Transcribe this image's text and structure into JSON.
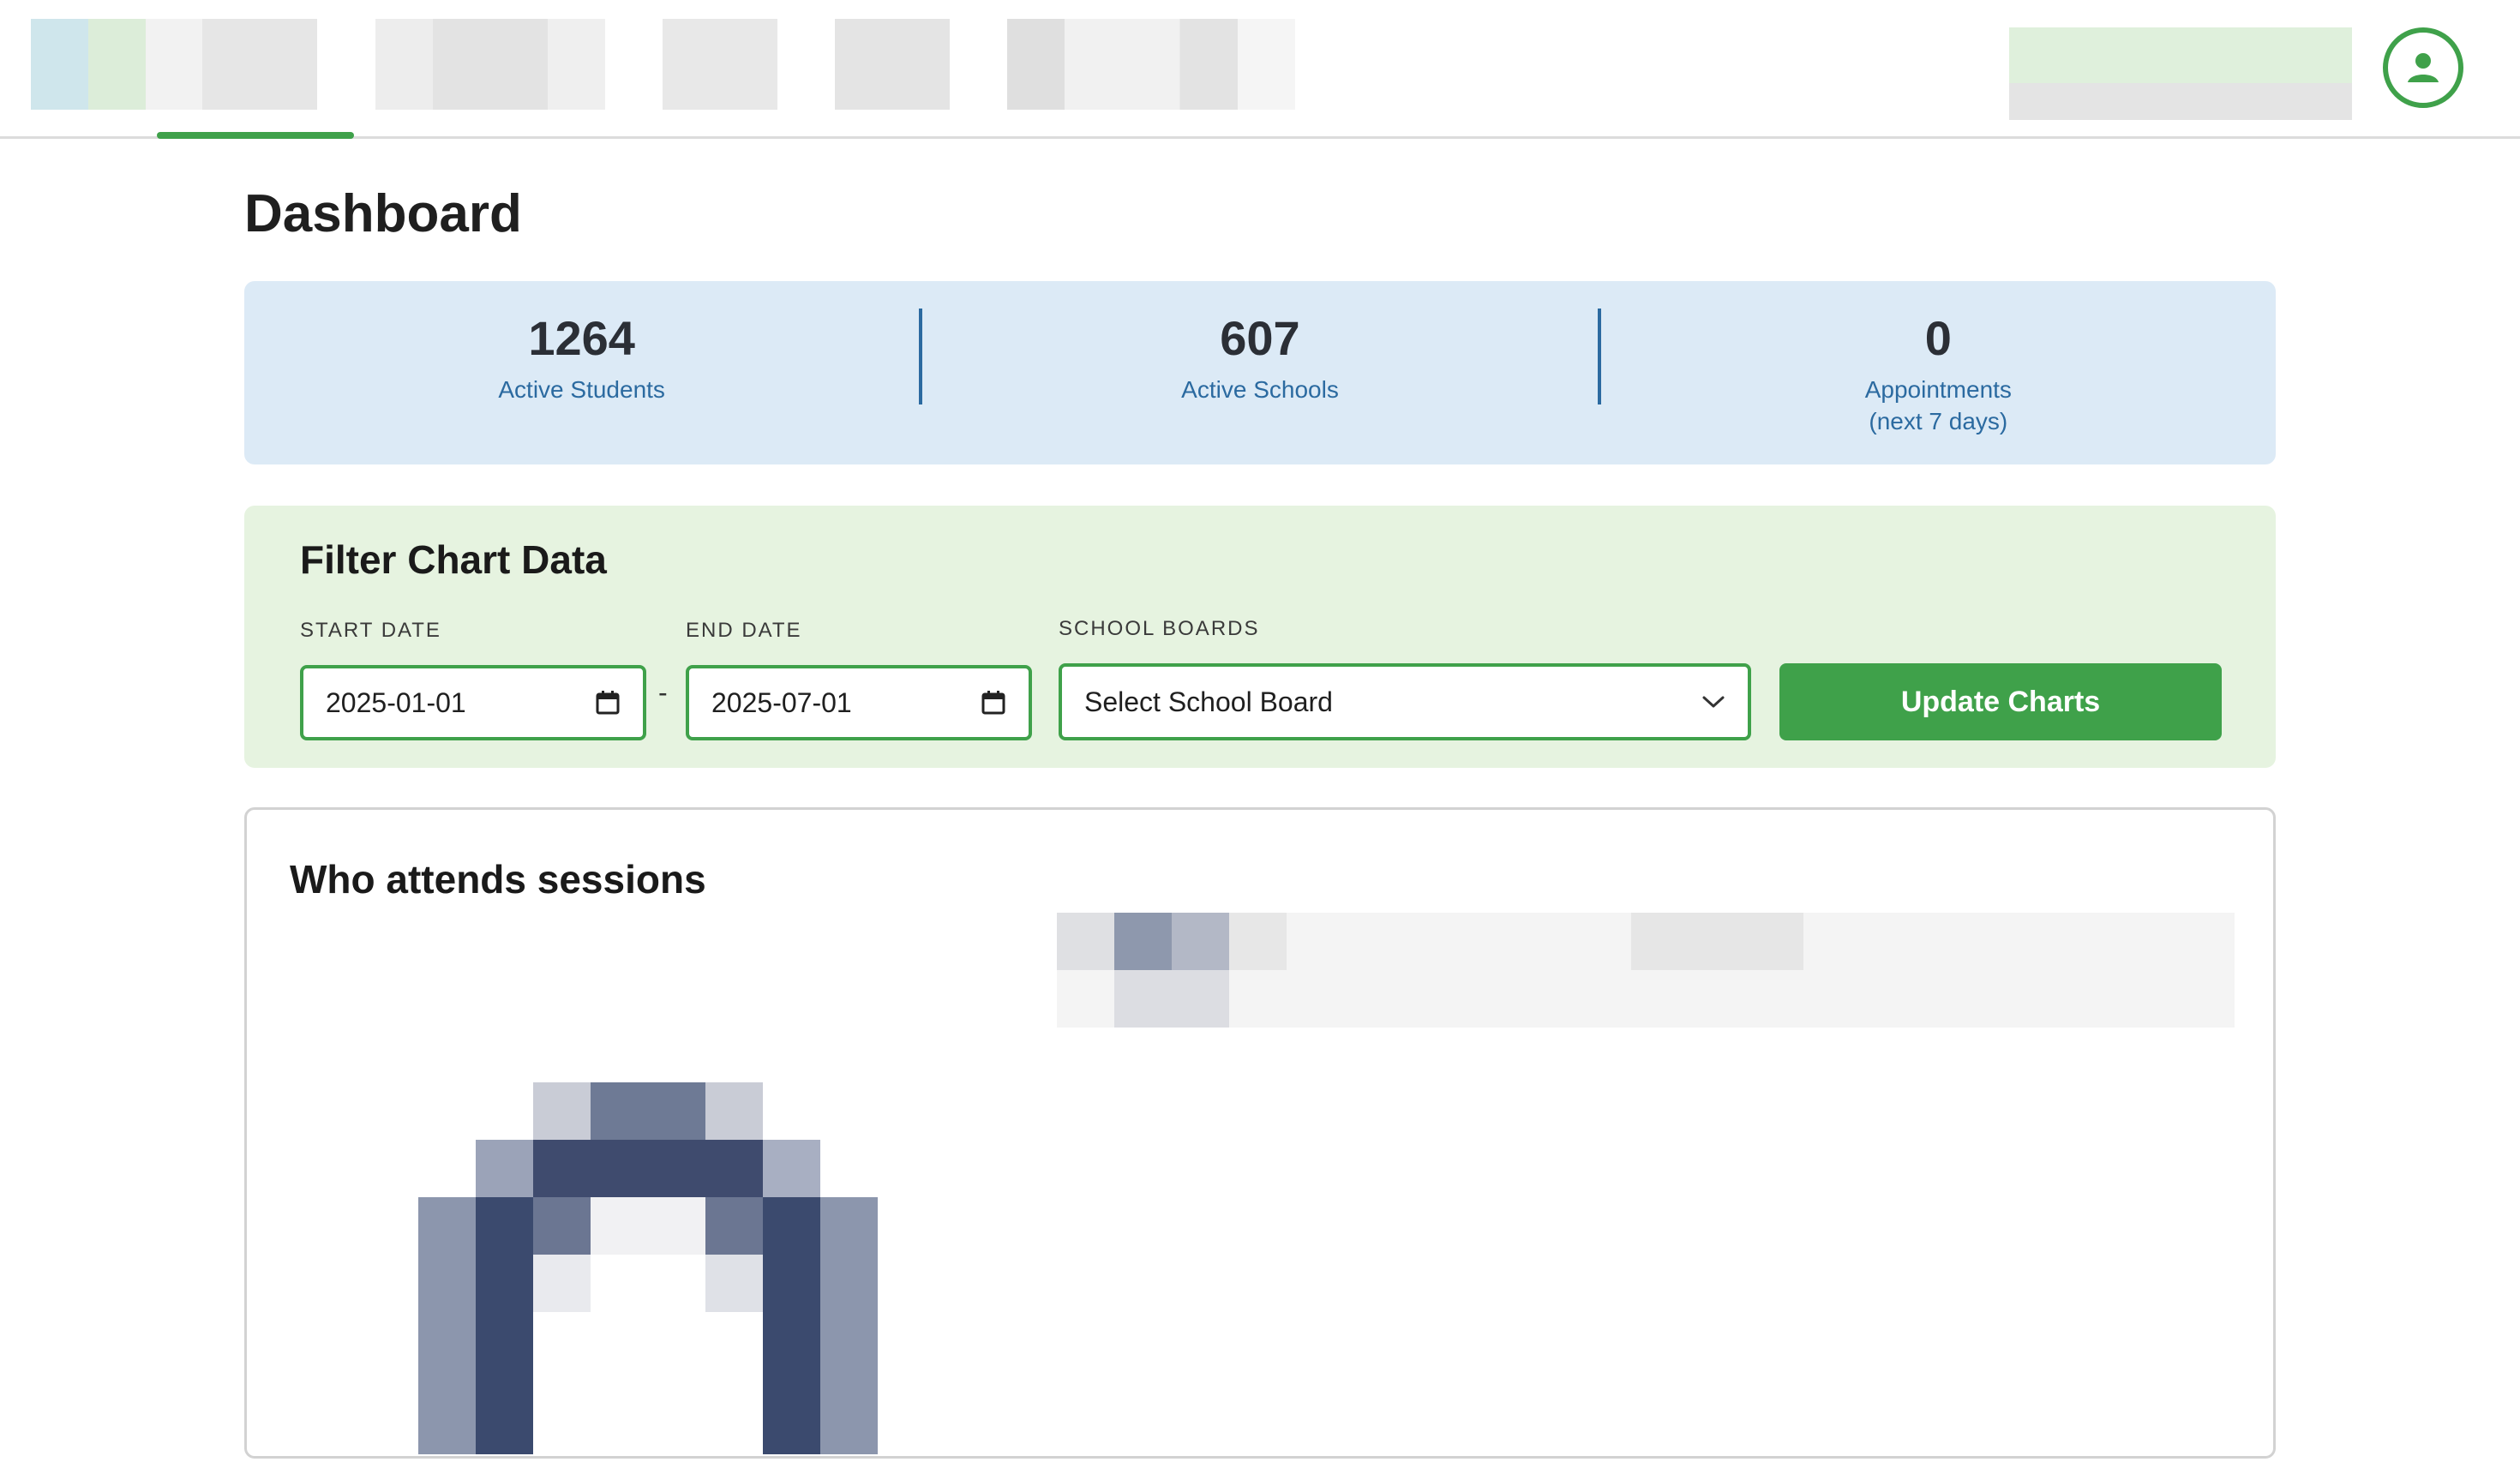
{
  "page": {
    "title": "Dashboard"
  },
  "stats": [
    {
      "value": "1264",
      "label": "Active Students",
      "sub": ""
    },
    {
      "value": "607",
      "label": "Active Schools",
      "sub": ""
    },
    {
      "value": "0",
      "label": "Appointments",
      "sub": "(next 7 days)"
    }
  ],
  "filter": {
    "title": "Filter Chart Data",
    "start_label": "START DATE",
    "start_value": "2025-01-01",
    "end_label": "END DATE",
    "end_value": "2025-07-01",
    "separator": "-",
    "boards_label": "SCHOOL BOARDS",
    "boards_value": "Select School Board",
    "update_label": "Update Charts"
  },
  "chart": {
    "title": "Who attends sessions"
  },
  "colors": {
    "brand_green": "#3fa14a",
    "stats_bg": "#dceaf6",
    "filter_bg": "#e6f3e0",
    "stat_label": "#2b6aa0"
  },
  "icons": {
    "account": "account-circle-icon",
    "calendar": "calendar-icon",
    "chevron": "chevron-down-icon"
  }
}
